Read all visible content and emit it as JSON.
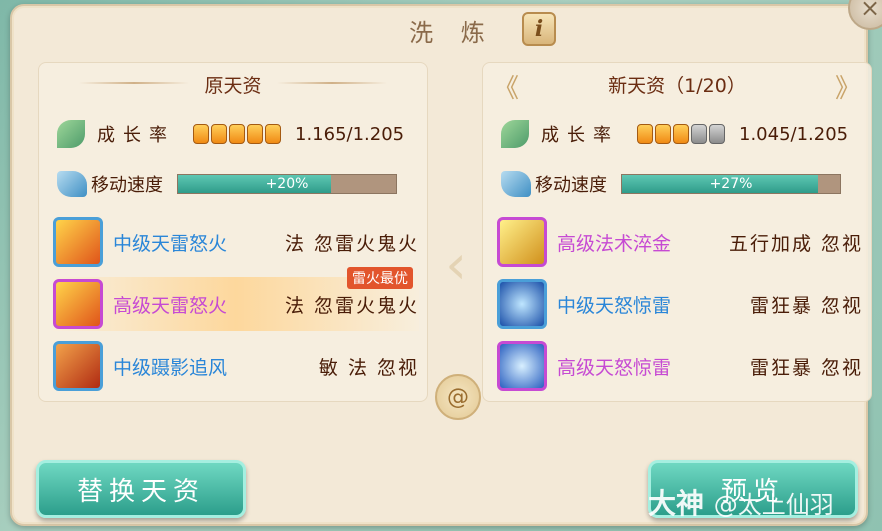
{
  "title": "洗 炼",
  "info_label": "i",
  "close_label": "×",
  "left": {
    "header": "原天资",
    "growth_label": "成长率",
    "growth_pips": [
      1,
      1,
      1,
      1,
      1
    ],
    "growth_value": "1.165/1.205",
    "speed_label": "移动速度",
    "speed_bar_text": "+20%",
    "speed_fill_fraction": 0.7,
    "skills": [
      {
        "name": "中级天雷怒火",
        "tags": "法 忽雷火鬼火",
        "rarity": "blue",
        "icon": "thunder-fire-icon"
      },
      {
        "name": "高级天雷怒火",
        "tags": "法 忽雷火鬼火",
        "rarity": "purple",
        "icon": "thunder-fire-icon",
        "badge": "雷火最优"
      },
      {
        "name": "中级蹑影追风",
        "tags": "敏 法 忽视",
        "rarity": "blue",
        "icon": "shadow-wind-icon"
      }
    ]
  },
  "right": {
    "header": "新天资（1/20）",
    "prev_arrow": "《",
    "next_arrow": "》",
    "growth_label": "成长率",
    "growth_pips": [
      1,
      1,
      1,
      0,
      0
    ],
    "growth_value": "1.045/1.205",
    "speed_label": "移动速度",
    "speed_bar_text": "+27%",
    "speed_fill_fraction": 0.9,
    "skills": [
      {
        "name": "高级法术淬金",
        "tags": "五行加成 忽视",
        "rarity": "purple",
        "icon": "spell-temper-icon"
      },
      {
        "name": "中级天怒惊雷",
        "tags": "雷狂暴 忽视",
        "rarity": "blue",
        "icon": "thunder-wrath-icon"
      },
      {
        "name": "高级天怒惊雷",
        "tags": "雷狂暴 忽视",
        "rarity": "purple",
        "icon": "thunder-wrath-icon"
      }
    ]
  },
  "replace_button": "替换天资",
  "preview_button": "预览",
  "watermark": "大神",
  "watermark_user": "@太上仙羽",
  "colors": {
    "blue_skill": "#2a86d8",
    "purple_skill": "#c64ad3",
    "accent_teal": "#2f9c8a",
    "badge": "#e2552c"
  }
}
